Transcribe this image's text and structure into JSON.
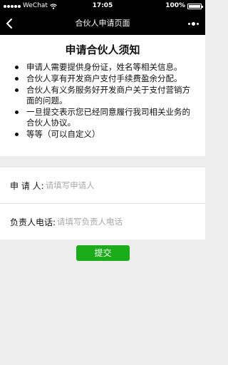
{
  "status_bar": {
    "carrier": "WeChat",
    "time": "17:05",
    "battery": "100%"
  },
  "nav": {
    "title": "合伙人申请页面"
  },
  "notice": {
    "title": "申请合伙人须知",
    "items": [
      "申请人需要提供身份证，姓名等相关信息。",
      "合伙人享有开发商户支付手续费盈余分配。",
      "合伙人有义务服务好开发商户关于支付营销方面的问题。",
      "一旦提交表示您已经同意履行我司相关业务的合伙人协议。",
      "等等（可以自定义）"
    ]
  },
  "form": {
    "applicant": {
      "label": "申 请 人:",
      "placeholder": "请填写申请人"
    },
    "phone": {
      "label": "负责人电话:",
      "placeholder": "请填写负责人电话"
    }
  },
  "submit": {
    "label": "提交",
    "color": "#1aad19"
  },
  "colors": {
    "header_background": "#000000",
    "page_background": "#ededed"
  }
}
